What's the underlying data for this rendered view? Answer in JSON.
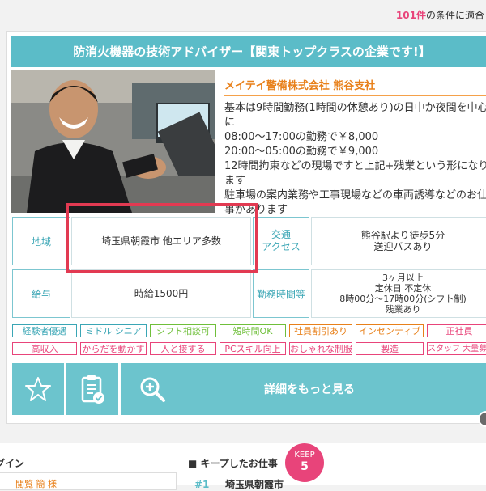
{
  "header": {
    "count_num": "101件",
    "count_suffix": "の条件に適合"
  },
  "job": {
    "title": "防消火機器の技術アドバイザー【関東トップクラスの企業です!】",
    "company": "メイテイ警備株式会社 熊谷支社",
    "description": "基本は9時間勤務(1時間の休憩あり)の日中か夜間を中心に\n08:00〜17:00の勤務で￥8,000\n20:00〜05:00の勤務で￥9,000\n12時間拘束などの現場ですと上記+残業という形になります\n駐車場の案内業務や工事現場などの車両誘導などのお仕事があります"
  },
  "info": {
    "area_label": "地域",
    "area_value": "埼玉県朝霞市 他エリア多数",
    "access_label_1": "交通",
    "access_label_2": "アクセス",
    "access_value_1": "熊谷駅より徒歩5分",
    "access_value_2": "送迎バスあり",
    "pay_label": "給与",
    "pay_value": "時給1500円",
    "hours_label": "勤務時間等",
    "hours_value_1": "3ヶ月以上",
    "hours_value_2": "定休日 不定休",
    "hours_value_3": "8時00分〜17時00分(シフト制)",
    "hours_value_4": "残業あり"
  },
  "tags_row1": [
    {
      "label": "経験者優遇",
      "color": "#3aa6b5"
    },
    {
      "label": "ミドル シニア",
      "color": "#3aa6b5"
    },
    {
      "label": "シフト相談可",
      "color": "#6fbf3a"
    },
    {
      "label": "短時間OK",
      "color": "#6fbf3a"
    },
    {
      "label": "社員割引あり",
      "color": "#e8801a"
    },
    {
      "label": "インセンティブ",
      "color": "#e8801a"
    },
    {
      "label": "正社員",
      "color": "#e8447a"
    }
  ],
  "tags_row2": [
    {
      "label": "高収入",
      "color": "#e8447a"
    },
    {
      "label": "からだを動かす",
      "color": "#e8447a"
    },
    {
      "label": "人と接する",
      "color": "#e8447a"
    },
    {
      "label": "PCスキル向上",
      "color": "#e8447a"
    },
    {
      "label": "おしゃれな制服",
      "color": "#e8447a"
    },
    {
      "label": "製造",
      "color": "#e8447a"
    },
    {
      "label": "スタッフ 大量募集",
      "color": "#e8447a"
    }
  ],
  "actions": {
    "more_label": "詳細をもっと見る",
    "favorite_icon": "star-icon",
    "apply_icon": "clipboard-check-icon",
    "search_icon": "magnifier-plus-icon"
  },
  "bottom": {
    "login_label": "グイン",
    "login_box_text": "閲覧 簡 様",
    "keep_label": "キープしたお仕事",
    "keep_badge_title": "KEEP",
    "keep_badge_count": "5",
    "keep_item_num": "#1",
    "keep_item_text": "埼玉県朝霞市"
  },
  "colors": {
    "accent": "#5bbcc8",
    "highlight": "#e23a52",
    "pink": "#e8447a",
    "orange": "#e8801a"
  }
}
